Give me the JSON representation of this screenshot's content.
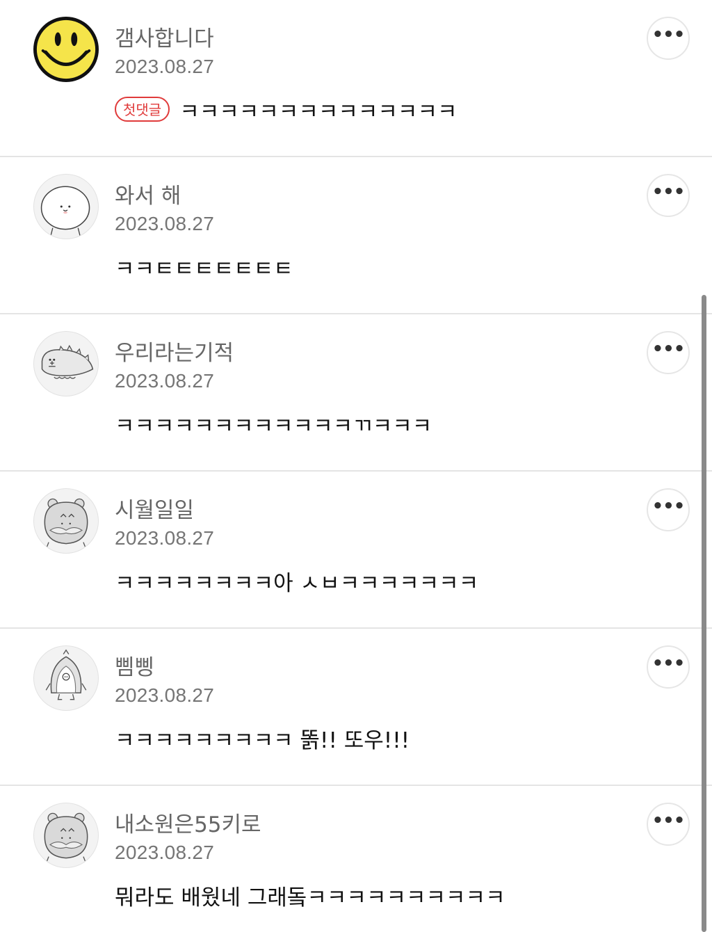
{
  "comments": [
    {
      "avatar_icon": "smiley-face-icon",
      "author": "갬사합니다",
      "date": "2023.08.27",
      "badge": "첫댓글",
      "text": "ㅋㅋㅋㅋㅋㅋㅋㅋㅋㅋㅋㅋㅋㅋ",
      "more_label": "•••"
    },
    {
      "avatar_icon": "rice-cake-character-icon",
      "author": "와서 해",
      "date": "2023.08.27",
      "text": "ㅋㅋㅌㅌㅌㅌㅌㅌㅌ",
      "more_label": "•••"
    },
    {
      "avatar_icon": "dinosaur-character-icon",
      "author": "우리라는기적",
      "date": "2023.08.27",
      "text": "ㅋㅋㅋㅋㅋㅋㅋㅋㅋㅋㅋㅋㄲㅋㅋㅋ",
      "more_label": "•••"
    },
    {
      "avatar_icon": "hamster-character-icon",
      "author": "시월일일",
      "date": "2023.08.27",
      "text": "ㅋㅋㅋㅋㅋㅋㅋㅋ아 ㅅㅂㅋㅋㅋㅋㅋㅋㅋ",
      "more_label": "•••"
    },
    {
      "avatar_icon": "penguin-character-icon",
      "author": "삠삥",
      "date": "2023.08.27",
      "text": "ㅋㅋㅋㅋㅋㅋㅋㅋㅋ 똙!! 또우!!!",
      "more_label": "•••"
    },
    {
      "avatar_icon": "hamster-character-icon",
      "author": "내소원은55키로",
      "date": "2023.08.27",
      "text": "뭐라도 배웠네 그래돜ㅋㅋㅋㅋㅋㅋㅋㅋㅋㅋ",
      "more_label": "•••"
    }
  ],
  "colors": {
    "badge": "#e03a3a",
    "author": "#666666",
    "date": "#757575",
    "divider": "#e4e4e4"
  }
}
